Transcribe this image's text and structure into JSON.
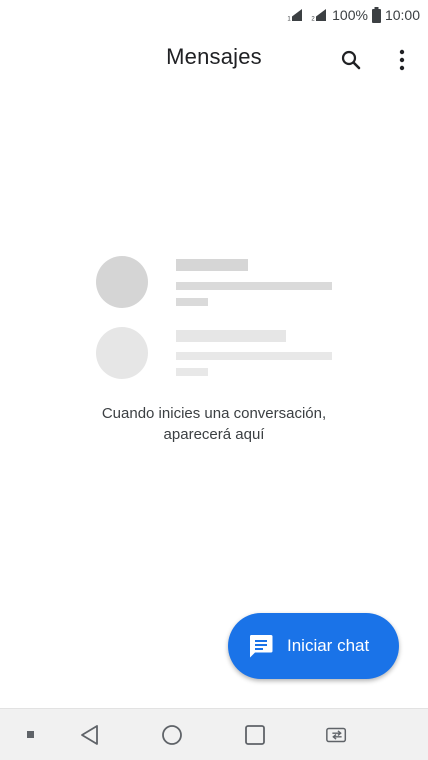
{
  "status_bar": {
    "battery_percent": "100%",
    "time": "10:00",
    "icons": [
      "sim1-signal-icon",
      "sim2-signal-icon",
      "battery-icon"
    ]
  },
  "app_bar": {
    "title": "Mensajes",
    "icons": [
      "search-icon",
      "more-vert-icon"
    ]
  },
  "empty_state": {
    "message_line1": "Cuando inicies una conversación,",
    "message_line2": "aparecerá aquí"
  },
  "fab": {
    "label": "Iniciar chat",
    "icon": "chat-icon",
    "color": "#1a73e8"
  },
  "nav_bar": {
    "icons": [
      "dot-icon",
      "back-icon",
      "home-icon",
      "recents-icon",
      "switch-sim-icon"
    ]
  }
}
